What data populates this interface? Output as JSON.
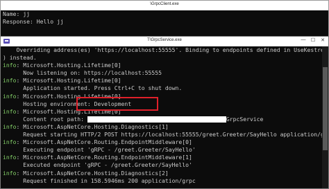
{
  "client_window": {
    "title": "\\GrpcClient.exe",
    "lines": [
      "Name: jj",
      "Response: Hello jj"
    ]
  },
  "service_window": {
    "title": "T\\GrpcService.exe",
    "lines": [
      {
        "prefix": "",
        "text": "    Overriding address(es) 'https://localhost:55555'. Binding to endpoints defined in UseKestrel("
      },
      {
        "prefix": "",
        "text": ") instead."
      },
      {
        "prefix": "info",
        "text": ": Microsoft.Hosting.Lifetime[0]"
      },
      {
        "prefix": "",
        "text": "      Now listening on: https://localhost:55555"
      },
      {
        "prefix": "info",
        "text": ": Microsoft.Hosting.Lifetime[0]"
      },
      {
        "prefix": "",
        "text": "      Application started. Press Ctrl+C to shut down."
      },
      {
        "prefix": "info",
        "text": ": Microsoft.Hosting.Lifetime[0]"
      },
      {
        "prefix": "",
        "text": "      Hosting environment: Development"
      },
      {
        "prefix": "info",
        "text": ": Microsoft.Hosting.Lifetime[0]"
      },
      {
        "prefix": "",
        "text": "      Content root path: ",
        "suffix": "GrpcService",
        "redacted": true
      },
      {
        "prefix": "info",
        "text": ": Microsoft.AspNetCore.Hosting.Diagnostics[1]"
      },
      {
        "prefix": "",
        "text": "      Request starting HTTP/2 POST https://localhost:55555/greet.Greeter/SayHello application/grpc"
      },
      {
        "prefix": "info",
        "text": ": Microsoft.AspNetCore.Routing.EndpointMiddleware[0]"
      },
      {
        "prefix": "",
        "text": "      Executing endpoint 'gRPC - /greet.Greeter/SayHello'"
      },
      {
        "prefix": "info",
        "text": ": Microsoft.AspNetCore.Routing.EndpointMiddleware[1]"
      },
      {
        "prefix": "",
        "text": "      Executed endpoint 'gRPC - /greet.Greeter/SayHello'"
      },
      {
        "prefix": "info",
        "text": ": Microsoft.AspNetCore.Hosting.Diagnostics[2]"
      },
      {
        "prefix": "",
        "text": "      Request finished in 158.5946ms 200 application/grpc"
      }
    ]
  },
  "controls": {
    "minimize": "—",
    "maximize": "☐",
    "close": "✕"
  },
  "colors": {
    "info": "#86d36a",
    "highlight": "#e0202a",
    "console_bg": "#0c0c0c"
  }
}
